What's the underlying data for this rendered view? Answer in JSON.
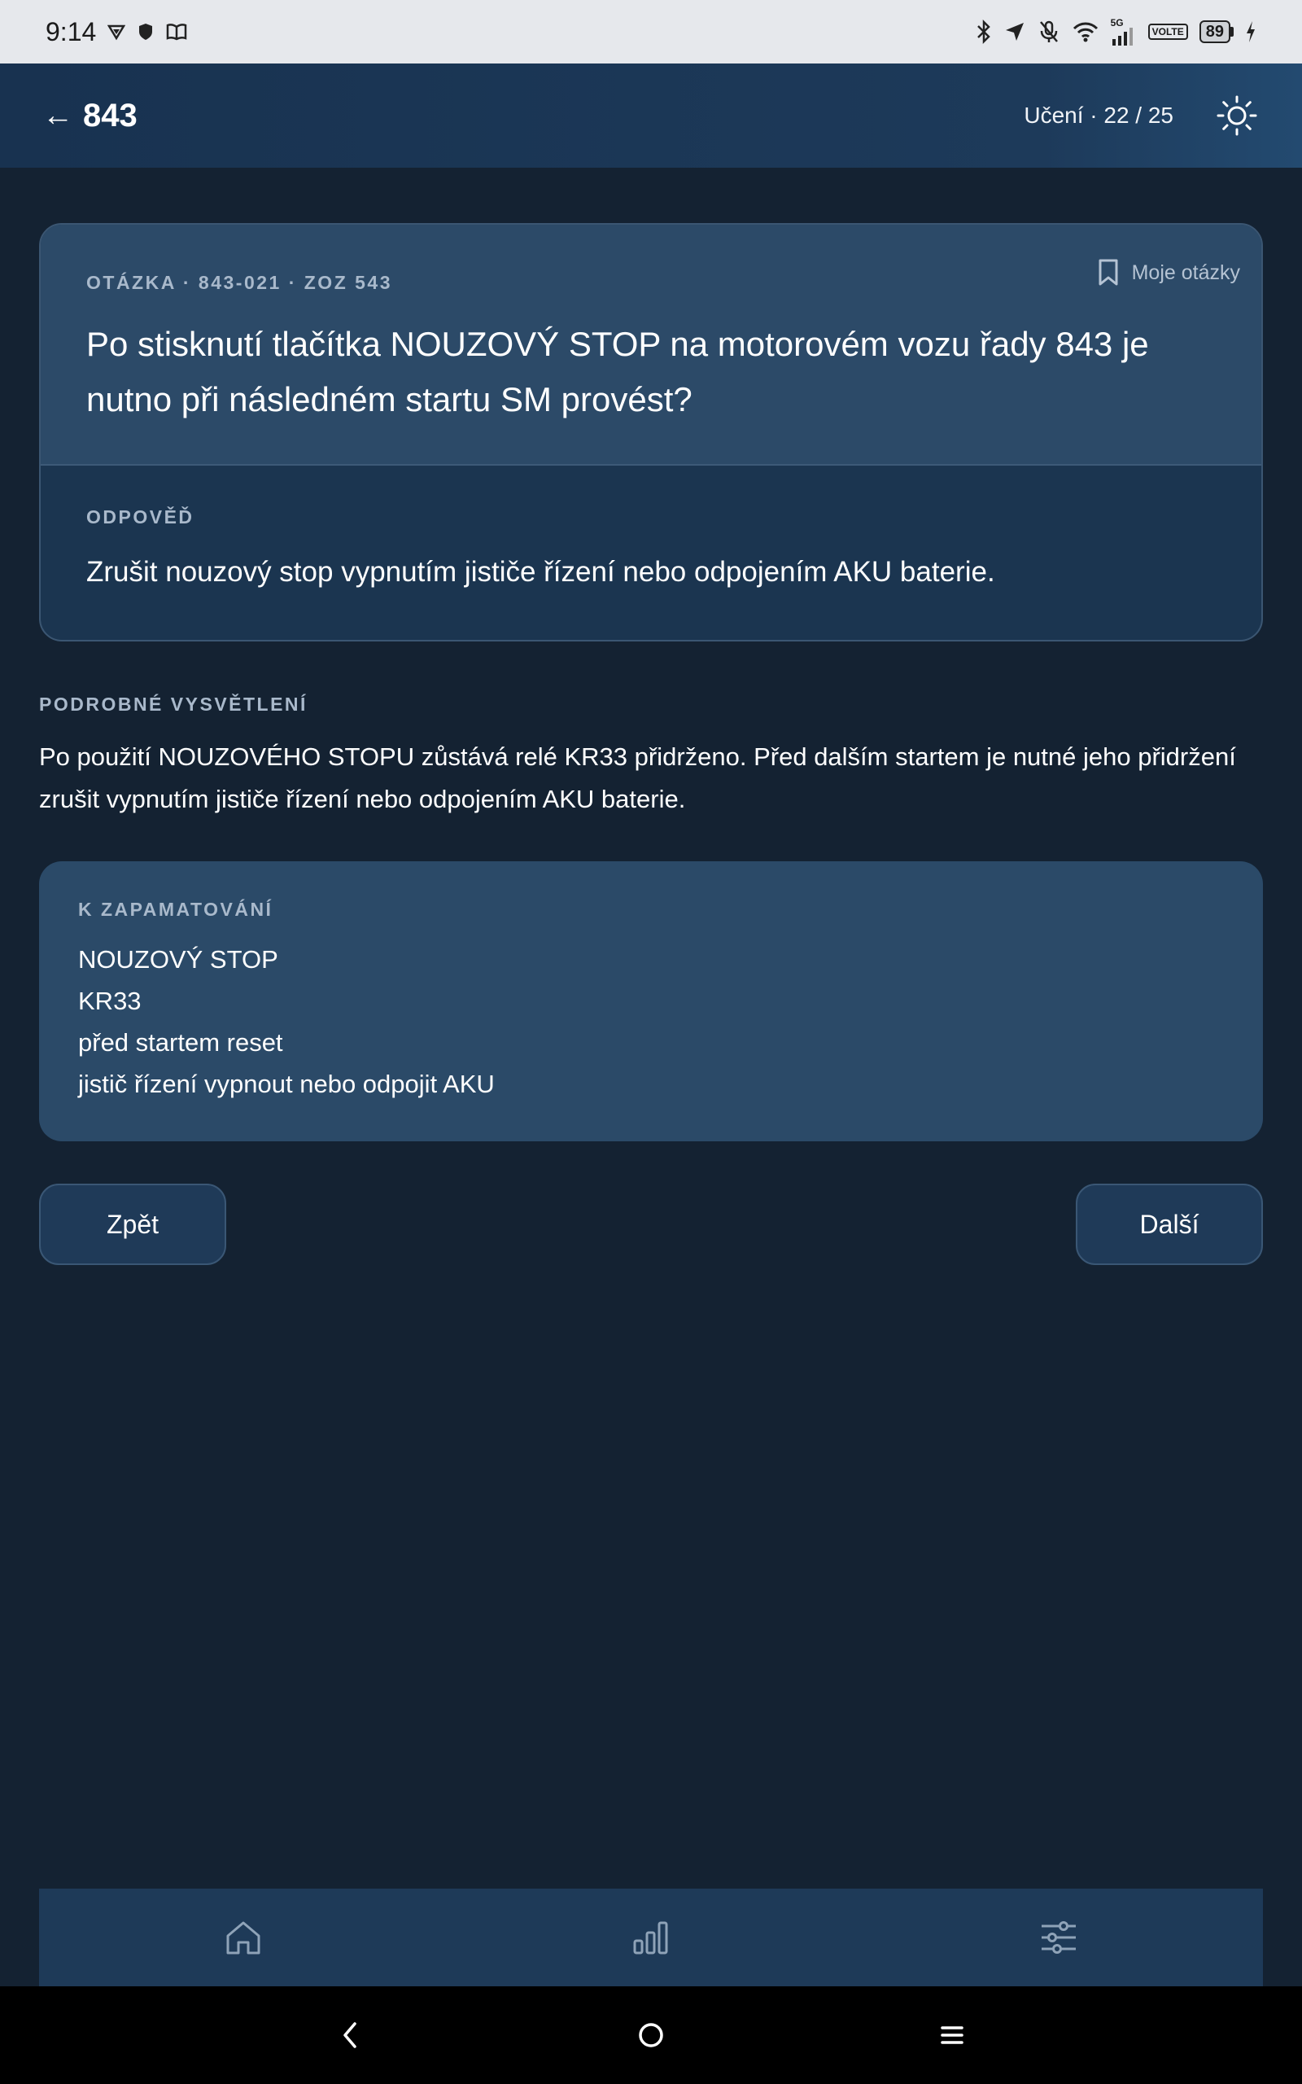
{
  "status_bar": {
    "time": "9:14",
    "network": "5G",
    "volte": "VOLTE",
    "battery": "89"
  },
  "app_bar": {
    "back_icon": "←",
    "title": "843",
    "progress": "Učení · 22 / 25",
    "theme_icon": "sun-icon"
  },
  "question": {
    "meta": "OTÁZKA · 843-021 · ZOZ 543",
    "bookmark_label": "Moje otázky",
    "text": "Po stisknutí tlačítka NOUZOVÝ STOP na motorovém vozu řady 843 je nutno při následném startu SM provést?",
    "answer_label": "ODPOVĚĎ",
    "answer_text": "Zrušit nouzový stop vypnutím jističe řízení nebo odpojením AKU baterie."
  },
  "explanation": {
    "label": "PODROBNÉ VYSVĚTLENÍ",
    "text": "Po použití NOUZOVÉHO STOPU zůstává relé KR33 přidrženo. Před dalším startem je nutné jeho přidržení zrušit vypnutím jističe řízení nebo odpojením AKU baterie."
  },
  "memorize": {
    "label": "K ZAPAMATOVÁNÍ",
    "items": [
      "NOUZOVÝ STOP",
      "KR33",
      "před startem reset",
      "jistič řízení vypnout nebo odpojit AKU"
    ]
  },
  "navigation": {
    "back_label": "Zpět",
    "next_label": "Další"
  },
  "bottom_nav": {
    "items": [
      "home-icon",
      "stats-icon",
      "settings-sliders-icon"
    ]
  },
  "colors": {
    "background": "#142232",
    "card_top": "#2c4a68",
    "card_bottom": "#1b3550",
    "muted_label": "#a9b9cb",
    "app_bar": "#1d3a5a"
  }
}
